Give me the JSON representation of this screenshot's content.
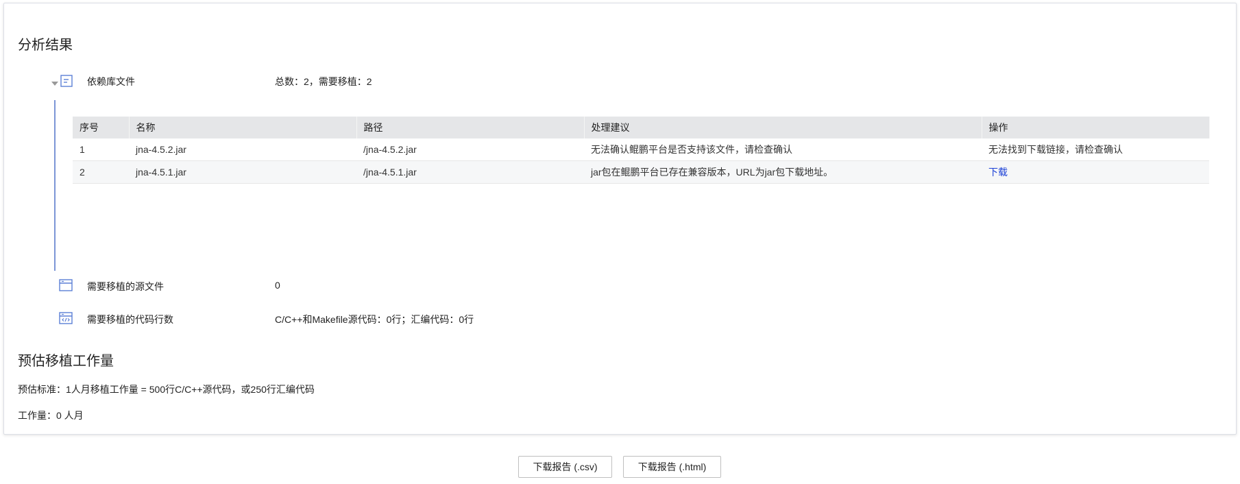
{
  "analysis": {
    "title": "分析结果",
    "dependency": {
      "label": "依赖库文件",
      "summary": "总数：2，需要移植：2",
      "table": {
        "headers": [
          "序号",
          "名称",
          "路径",
          "处理建议",
          "操作"
        ],
        "rows": [
          {
            "index": "1",
            "name": "jna-4.5.2.jar",
            "path": "/jna-4.5.2.jar",
            "advice": "无法确认鲲鹏平台是否支持该文件，请检查确认",
            "action": "无法找到下载链接，请检查确认"
          },
          {
            "index": "2",
            "name": "jna-4.5.1.jar",
            "path": "/jna-4.5.1.jar",
            "advice": "jar包在鲲鹏平台已存在兼容版本，URL为jar包下载地址。",
            "action": "下载"
          }
        ]
      }
    },
    "source_files": {
      "label": "需要移植的源文件",
      "value": "0"
    },
    "code_lines": {
      "label": "需要移植的代码行数",
      "value": "C/C++和Makefile源代码：0行；汇编代码：0行"
    }
  },
  "estimate": {
    "title": "预估移植工作量",
    "standard": "预估标准：1人月移植工作量 = 500行C/C++源代码，或250行汇编代码",
    "workload": "工作量：0 人月"
  },
  "buttons": {
    "csv": "下载报告 (.csv)",
    "html": "下载报告 (.html)"
  }
}
